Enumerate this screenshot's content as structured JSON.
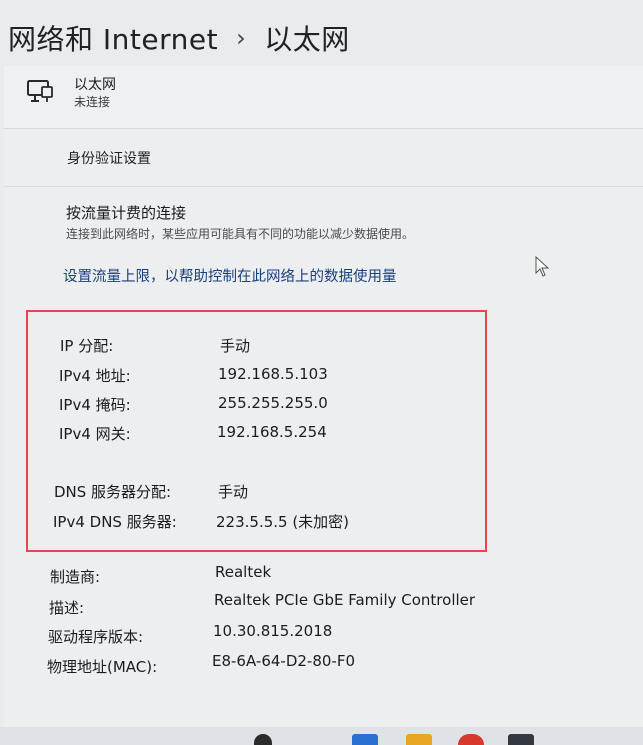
{
  "breadcrumb": {
    "parent": "网络和 Internet",
    "separator": "›",
    "current": "以太网"
  },
  "adapter": {
    "name": "以太网",
    "status": "未连接",
    "icon": "ethernet-monitor-icon"
  },
  "auth_settings_label": "身份验证设置",
  "metered": {
    "title": "按流量计费的连接",
    "description": "连接到此网络时，某些应用可能具有不同的功能以减少数据使用。"
  },
  "data_limit_link": "设置流量上限，以帮助控制在此网络上的数据使用量",
  "ip_details": [
    {
      "label": "IP 分配:",
      "value": "手动"
    },
    {
      "label": "IPv4 地址:",
      "value": "192.168.5.103"
    },
    {
      "label": "IPv4 掩码:",
      "value": "255.255.255.0"
    },
    {
      "label": "IPv4 网关:",
      "value": "192.168.5.254"
    },
    {
      "label": "DNS 服务器分配:",
      "value": "手动"
    },
    {
      "label": "IPv4 DNS 服务器:",
      "value": "223.5.5.5 (未加密)"
    }
  ],
  "hardware_details": [
    {
      "label": "制造商:",
      "value": "Realtek"
    },
    {
      "label": "描述:",
      "value": "Realtek PCIe GbE Family Controller"
    },
    {
      "label": "驱动程序版本:",
      "value": "10.30.815.2018"
    },
    {
      "label": "物理地址(MAC):",
      "value": "E8-6A-64-D2-80-F0"
    }
  ],
  "colors": {
    "highlight_border": "#e8454c",
    "link": "#1a3f7a"
  }
}
